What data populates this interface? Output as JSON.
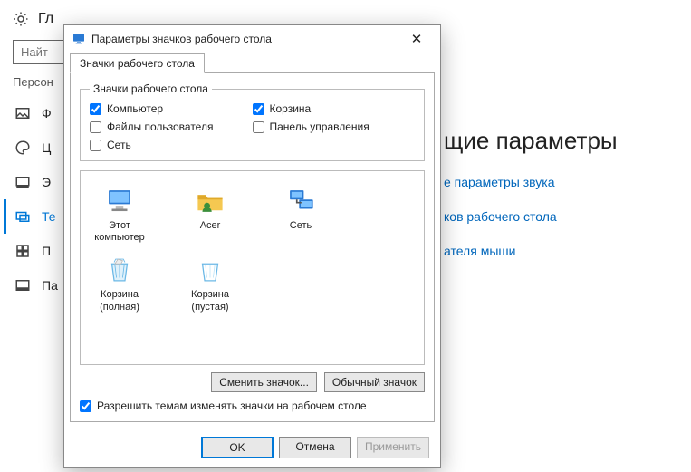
{
  "bg": {
    "title_partial": "Гл",
    "search_placeholder": "Найт",
    "section_label": "Персон",
    "nav": [
      {
        "label": "Ф"
      },
      {
        "label": "Ц"
      },
      {
        "label": "Э"
      },
      {
        "label": "Те"
      },
      {
        "label": "П"
      },
      {
        "label": "Па"
      }
    ],
    "right_heading": "щие параметры",
    "links": [
      "е параметры звука",
      "ков рабочего стола",
      "ателя мыши"
    ]
  },
  "dialog": {
    "title": "Параметры значков рабочего стола",
    "tab": "Значки рабочего стола",
    "group_legend": "Значки рабочего стола",
    "checks": {
      "computer": {
        "label": "Компьютер",
        "checked": true
      },
      "recycle": {
        "label": "Корзина",
        "checked": true
      },
      "user": {
        "label": "Файлы пользователя",
        "checked": false
      },
      "cpl": {
        "label": "Панель управления",
        "checked": false
      },
      "network": {
        "label": "Сеть",
        "checked": false
      }
    },
    "icons": [
      {
        "name": "Этот\nкомпьютер",
        "kind": "pc"
      },
      {
        "name": "Acer",
        "kind": "user"
      },
      {
        "name": "Сеть",
        "kind": "net"
      },
      {
        "name": "Корзина\n(полная)",
        "kind": "bin-full"
      },
      {
        "name": "Корзина\n(пустая)",
        "kind": "bin-empty"
      }
    ],
    "change_btn": "Сменить значок...",
    "default_btn": "Обычный значок",
    "allow_label": "Разрешить темам изменять значки на рабочем столе",
    "allow_checked": true,
    "ok": "OK",
    "cancel": "Отмена",
    "apply": "Применить"
  }
}
